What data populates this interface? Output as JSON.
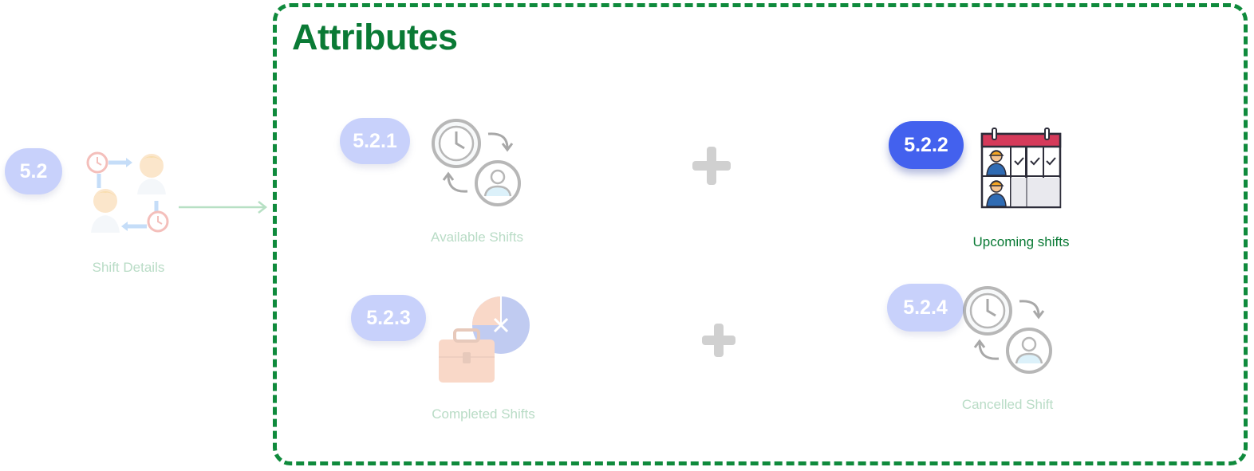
{
  "source": {
    "badge": "5.2",
    "label": "Shift Details"
  },
  "frame": {
    "title": "Attributes"
  },
  "attributes": [
    {
      "badge": "5.2.1",
      "label": "Available Shifts",
      "icon": "clock-user-cycle-icon",
      "active": false
    },
    {
      "badge": "5.2.2",
      "label": "Upcoming shifts",
      "icon": "calendar-workers-icon",
      "active": true
    },
    {
      "badge": "5.2.3",
      "label": "Completed Shifts",
      "icon": "briefcase-clock-icon",
      "active": false
    },
    {
      "badge": "5.2.4",
      "label": "Cancelled Shift",
      "icon": "clock-user-cycle-icon",
      "active": false
    }
  ],
  "colors": {
    "frame_border": "#0f8a3c",
    "title": "#0a7a35",
    "badge_inactive": "#c8d1fb",
    "badge_active": "#4361ee",
    "caption_inactive": "#b9dcc6",
    "caption_active": "#0a7a35",
    "connector_arrow": "#b7e0c4",
    "plus_sign": "#d0d0d0"
  }
}
